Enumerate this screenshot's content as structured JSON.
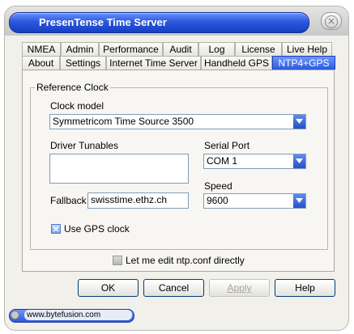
{
  "window": {
    "title": "PresenTense Time Server",
    "close_glyph": "×"
  },
  "tabs": {
    "row1": [
      "NMEA",
      "Admin",
      "Performance",
      "Audit",
      "Log",
      "License",
      "Live Help"
    ],
    "row2": [
      "About",
      "Settings",
      "Internet Time Server",
      "Handheld GPS",
      "NTP4+GPS"
    ],
    "active": "NTP4+GPS"
  },
  "reference_clock": {
    "group_label": "Reference Clock",
    "clock_model_label": "Clock model",
    "clock_model_value": "Symmetricom Time Source 3500",
    "driver_tunables_label": "Driver  Tunables",
    "driver_tunables_value": "",
    "serial_port_label": "Serial Port",
    "serial_port_value": "COM 1",
    "speed_label": "Speed",
    "speed_value": "9600",
    "fallback_label": "Fallback",
    "fallback_value": "swisstime.ethz.ch",
    "use_gps_label": "Use GPS clock",
    "use_gps_checked": true
  },
  "edit_ntp_conf_label": "Let me edit ntp.conf directly",
  "edit_ntp_conf_checked": false,
  "buttons": {
    "ok": "OK",
    "cancel": "Cancel",
    "apply": "Apply",
    "help": "Help"
  },
  "status": {
    "url": "www.bytefusion.com"
  },
  "colors": {
    "title_blue": "#2c58de",
    "active_tab": "#2c5ae0",
    "window_bg": "#f1f0ea"
  },
  "icons": [
    "close-icon",
    "dropdown-arrow-icon",
    "checkmark-icon"
  ]
}
